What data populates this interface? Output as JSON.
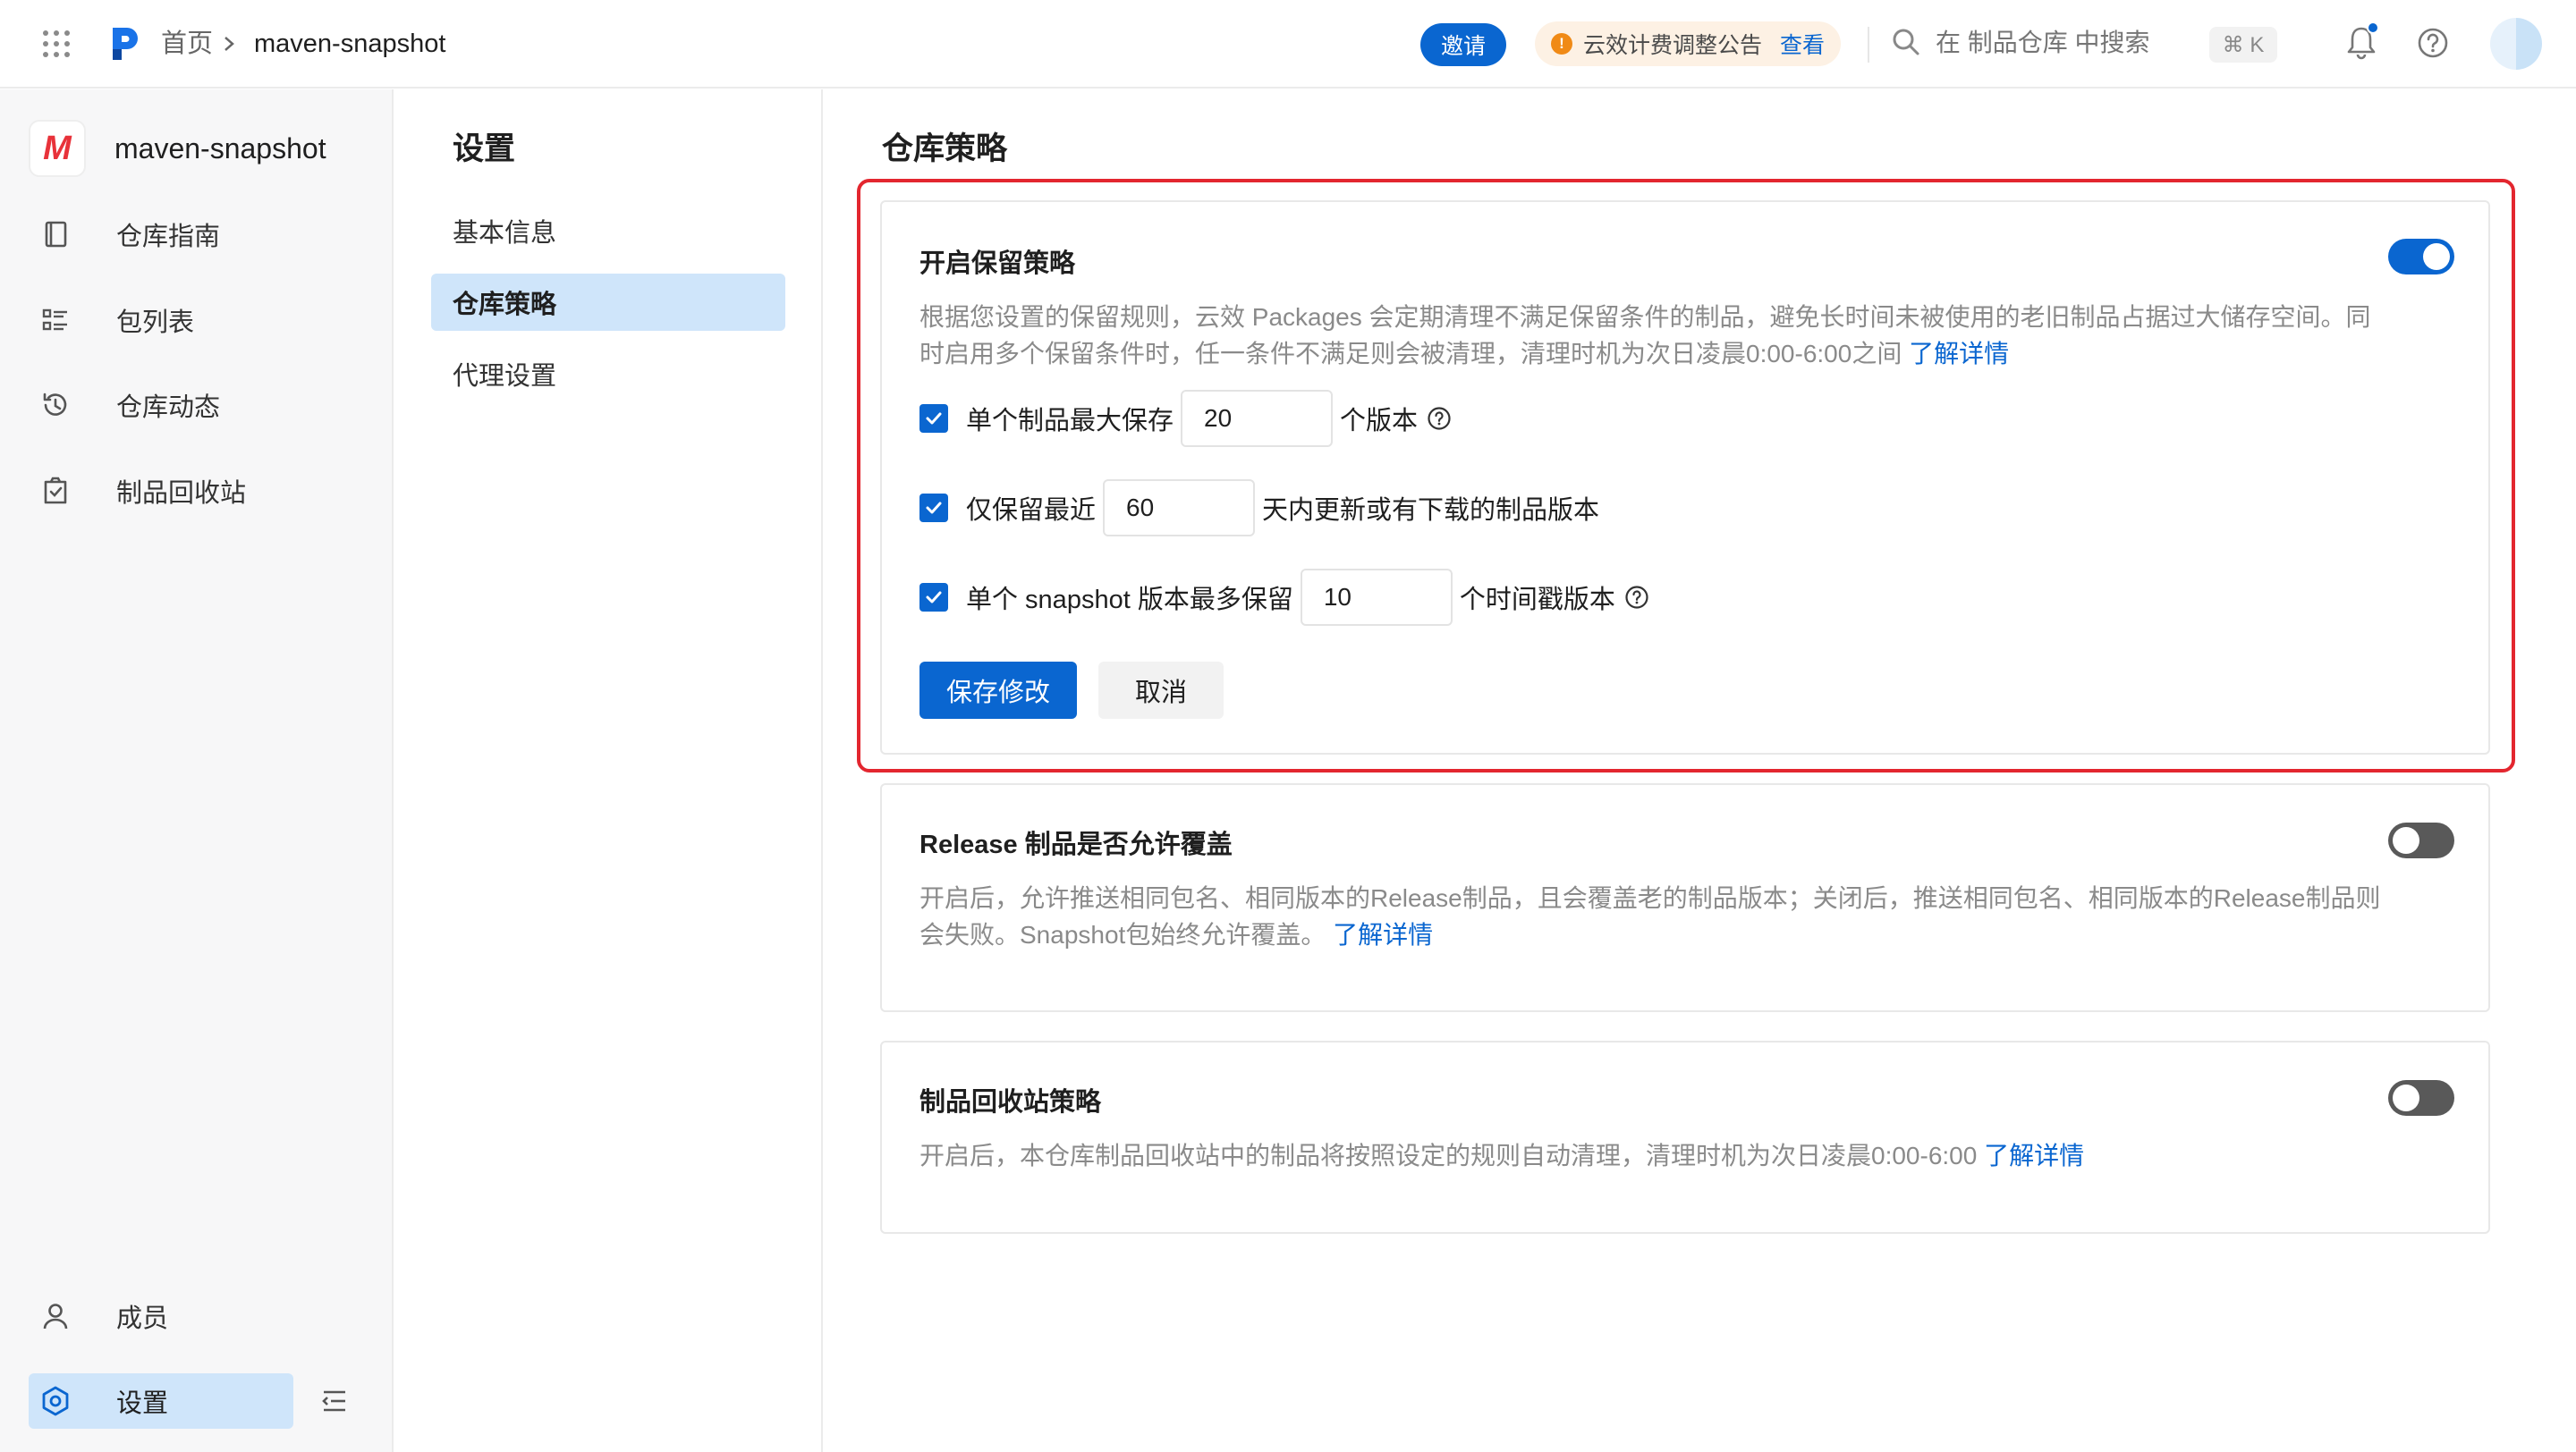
{
  "header": {
    "breadcrumb_home": "首页",
    "breadcrumb_current": "maven-snapshot",
    "invite_label": "邀请",
    "notice_text": "云效计费调整公告",
    "notice_link": "查看",
    "search_placeholder": "在 制品仓库 中搜索",
    "search_shortcut": "⌘ K"
  },
  "sidebar": {
    "repo_logo": "M",
    "repo_name": "maven-snapshot",
    "items": [
      {
        "label": "仓库指南",
        "icon": "book-icon"
      },
      {
        "label": "包列表",
        "icon": "list-icon"
      },
      {
        "label": "仓库动态",
        "icon": "history-icon"
      },
      {
        "label": "制品回收站",
        "icon": "recycle-bin-icon"
      }
    ],
    "bottom_items": [
      {
        "label": "成员",
        "icon": "user-icon"
      },
      {
        "label": "设置",
        "icon": "settings-icon"
      }
    ],
    "active": "设置"
  },
  "subnav": {
    "title": "设置",
    "items": [
      "基本信息",
      "仓库策略",
      "代理设置"
    ],
    "active": "仓库策略"
  },
  "main": {
    "title": "仓库策略",
    "retention": {
      "title": "开启保留策略",
      "enabled": true,
      "desc_line1": "根据您设置的保留规则，云效 Packages 会定期清理不满足保留条件的制品，避免长时间未被使用的老旧制品占据过大储存空间。同",
      "desc_line2": "时启用多个保留条件时，任一条件不满足则会被清理，清理时机为次日凌晨0:00-6:00之间",
      "learn_more": "了解详情",
      "rule1_prefix": "单个制品最大保存",
      "rule1_value": "20",
      "rule1_suffix": "个版本",
      "rule2_prefix": "仅保留最近",
      "rule2_value": "60",
      "rule2_suffix": "天内更新或有下载的制品版本",
      "rule3_prefix": "单个 snapshot 版本最多保留",
      "rule3_value": "10",
      "rule3_suffix": "个时间戳版本",
      "save_label": "保存修改",
      "cancel_label": "取消"
    },
    "release_override": {
      "title": "Release 制品是否允许覆盖",
      "enabled": false,
      "desc_line1": "开启后，允许推送相同包名、相同版本的Release制品，且会覆盖老的制品版本；关闭后，推送相同包名、相同版本的Release制品则",
      "desc_line2": "会失败。Snapshot包始终允许覆盖。",
      "learn_more": "了解详情"
    },
    "recycle_policy": {
      "title": "制品回收站策略",
      "enabled": false,
      "desc": "开启后，本仓库制品回收站中的制品将按照设定的规则自动清理，清理时机为次日凌晨0:00-6:00",
      "learn_more": "了解详情"
    }
  },
  "colors": {
    "primary": "#0a66d0",
    "highlight_border": "#e3262f",
    "active_nav": "#cfe5fa",
    "toggle_off": "#595959"
  }
}
